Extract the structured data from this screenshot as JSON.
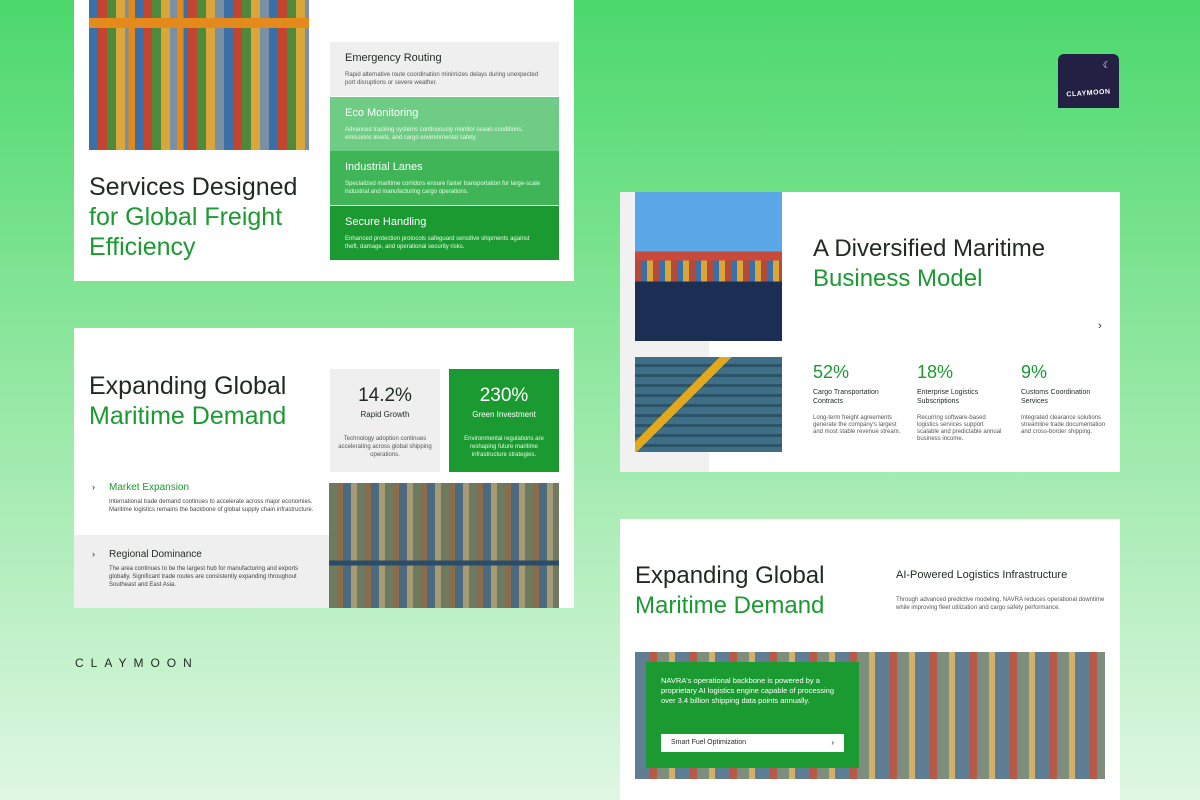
{
  "brand": {
    "wordmark": "CLAYMOON",
    "logo_text": "CLAYMOON",
    "logo_icon": "moon-icon",
    "colors": {
      "primary": "#1c9a32",
      "dark": "#232044"
    }
  },
  "slide1": {
    "title_line1": "Services Designed",
    "title_line2": "for Global Freight",
    "title_line3": "Efficiency",
    "services": [
      {
        "title": "Emergency Routing",
        "desc": "Rapid alternative route coordination minimizes delays during unexpected port disruptions or severe weather."
      },
      {
        "title": "Eco Monitoring",
        "desc": "Advanced tracking systems continuously monitor ocean conditions, emissions levels, and cargo environmental safety."
      },
      {
        "title": "Industrial Lanes",
        "desc": "Specialized maritime corridors ensure faster transportation for large-scale industrial and manufacturing cargo operations."
      },
      {
        "title": "Secure Handling",
        "desc": "Enhanced protection protocols safeguard sensitive shipments against theft, damage, and operational security risks."
      }
    ]
  },
  "slide2": {
    "title_line1": "Expanding Global",
    "title_line2": "Maritime Demand",
    "stats": [
      {
        "value": "14.2%",
        "label": "Rapid Growth",
        "desc": "Technology adoption continues accelerating across global shipping operations."
      },
      {
        "value": "230%",
        "label": "Green Investment",
        "desc": "Environmental regulations are reshaping future maritime infrastructure strategies."
      }
    ],
    "items": [
      {
        "title": "Market Expansion",
        "desc": "International trade demand continues to accelerate across major economies. Maritime logistics remains the backbone of global supply chain infrastructure."
      },
      {
        "title": "Regional Dominance",
        "desc": "The area continues to be the largest hub for manufacturing and exports globally. Significant trade routes are consistently expanding throughout Southeast and East Asia."
      }
    ],
    "chevron": "›"
  },
  "slide3": {
    "title_line1": "A Diversified Maritime",
    "title_line2": "Business Model",
    "next": "›",
    "kpis": [
      {
        "value": "52%",
        "label": "Cargo Transportation Contracts",
        "desc": "Long-term freight agreements generate the company's largest and most stable revenue stream."
      },
      {
        "value": "18%",
        "label": "Enterprise Logistics Subscriptions",
        "desc": "Recurring software-based logistics services support scalable and predictable annual business income."
      },
      {
        "value": "9%",
        "label": "Customs Coordination Services",
        "desc": "Integrated clearance solutions streamline trade documentation and cross-border shipping."
      }
    ]
  },
  "slide4": {
    "title_line1": "Expanding Global",
    "title_line2": "Maritime Demand",
    "heading": "AI-Powered Logistics Infrastructure",
    "body": "Through advanced predictive modeling, NAVRA reduces operational downtime while improving fleet utilization and cargo safety performance.",
    "callout": "NAVRA's operational backbone is powered by a proprietary AI logistics engine capable of processing over 3.4 billion shipping data points annually.",
    "button_label": "Smart Fuel Optimization",
    "button_chevron": "›"
  }
}
